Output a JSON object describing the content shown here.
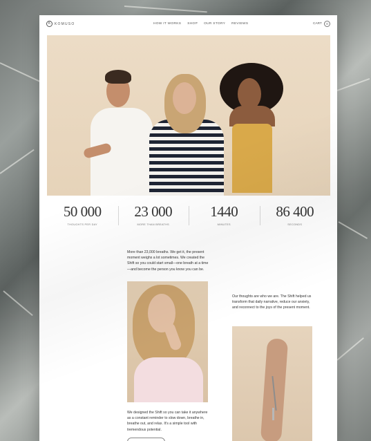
{
  "brand": {
    "name": "KOMUSO",
    "mark": "K"
  },
  "nav": {
    "links": [
      "HOW IT WORKS",
      "SHOP",
      "OUR STORY",
      "REVIEWS"
    ],
    "cart_label": "CART",
    "cart_count": "0"
  },
  "stats": [
    {
      "value": "50 000",
      "label": "THOUGHTS PER DAY"
    },
    {
      "value": "23 000",
      "label": "MORE THAN BREATHS"
    },
    {
      "value": "1440",
      "label": "MINUTES"
    },
    {
      "value": "86 400",
      "label": "SECONDS"
    }
  ],
  "content": {
    "intro": "More than 23,000 breaths. We get it, the present moment weighs a lot sometimes. We created the Shift so you could start small—one breath at a time—and become the person you know you can be.",
    "side": "Our thoughts are who we are. The Shift helped us transform that daily narrative, reduce our anxiety, and reconnect to the joys of the present moment.",
    "outro": "We designed the Shift so you can take it anywhere as a constant reminder to slow down, breathe in, breathe out, and relax. It's a simple tool with tremendous potential."
  }
}
